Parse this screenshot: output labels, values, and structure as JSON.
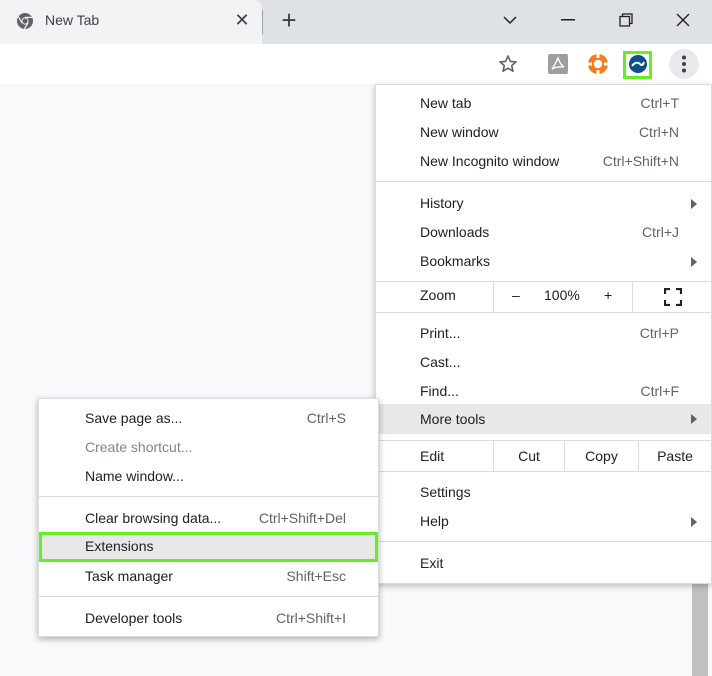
{
  "tab": {
    "title": "New Tab",
    "close": "✕"
  },
  "new_tab_glyph": "+",
  "window_controls": [
    "minimize",
    "restore",
    "close"
  ],
  "toolbar_icons": [
    "star-icon",
    "adobe-acrobat-icon",
    "lifebuoy-extension-icon",
    "blue-extension-icon",
    "more-menu-icon"
  ],
  "colors": {
    "highlight": "#66ee22",
    "hover": "#e8e8e8"
  },
  "main_menu": {
    "new_tab": {
      "label": "New tab",
      "shortcut": "Ctrl+T"
    },
    "new_window": {
      "label": "New window",
      "shortcut": "Ctrl+N"
    },
    "new_incognito": {
      "label": "New Incognito window",
      "shortcut": "Ctrl+Shift+N"
    },
    "history": {
      "label": "History"
    },
    "downloads": {
      "label": "Downloads",
      "shortcut": "Ctrl+J"
    },
    "bookmarks": {
      "label": "Bookmarks"
    },
    "zoom": {
      "label": "Zoom",
      "minus": "–",
      "value": "100%",
      "plus": "+"
    },
    "print": {
      "label": "Print...",
      "shortcut": "Ctrl+P"
    },
    "cast": {
      "label": "Cast..."
    },
    "find": {
      "label": "Find...",
      "shortcut": "Ctrl+F"
    },
    "more_tools": {
      "label": "More tools"
    },
    "edit": {
      "label": "Edit",
      "cut": "Cut",
      "copy": "Copy",
      "paste": "Paste"
    },
    "settings": {
      "label": "Settings"
    },
    "help": {
      "label": "Help"
    },
    "exit": {
      "label": "Exit"
    }
  },
  "more_tools_menu": {
    "save_page": {
      "label": "Save page as...",
      "shortcut": "Ctrl+S"
    },
    "create_shortcut": {
      "label": "Create shortcut..."
    },
    "name_window": {
      "label": "Name window..."
    },
    "clear_data": {
      "label": "Clear browsing data...",
      "shortcut": "Ctrl+Shift+Del"
    },
    "extensions": {
      "label": "Extensions"
    },
    "task_manager": {
      "label": "Task manager",
      "shortcut": "Shift+Esc"
    },
    "developer_tools": {
      "label": "Developer tools",
      "shortcut": "Ctrl+Shift+I"
    }
  }
}
